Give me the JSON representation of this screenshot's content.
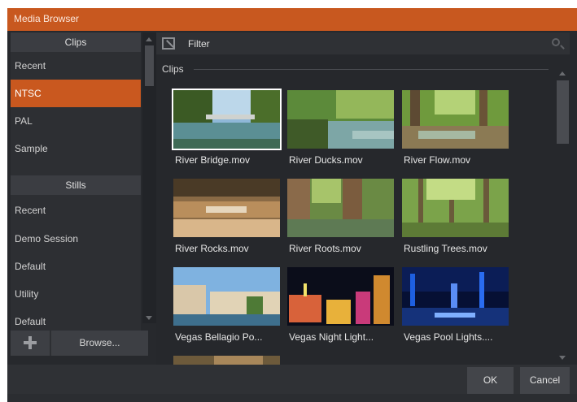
{
  "window": {
    "title": "Media Browser"
  },
  "sidebar": {
    "clips_header": "Clips",
    "clips_items": [
      {
        "label": "Recent",
        "selected": false
      },
      {
        "label": "NTSC",
        "selected": true
      },
      {
        "label": "PAL",
        "selected": false
      },
      {
        "label": "Sample",
        "selected": false
      }
    ],
    "stills_header": "Stills",
    "stills_items": [
      {
        "label": "Recent"
      },
      {
        "label": "Demo Session"
      },
      {
        "label": "Default"
      },
      {
        "label": "Utility"
      },
      {
        "label": "Default"
      }
    ],
    "add_icon": "plus-icon",
    "browse_label": "Browse..."
  },
  "filter": {
    "label": "Filter",
    "icon": "filter-icon",
    "search_icon": "search-icon"
  },
  "content": {
    "section_label": "Clips",
    "items": [
      {
        "label": "River Bridge.mov",
        "selected": true
      },
      {
        "label": "River Ducks.mov",
        "selected": false
      },
      {
        "label": "River Flow.mov",
        "selected": false
      },
      {
        "label": "River Rocks.mov",
        "selected": false
      },
      {
        "label": "River Roots.mov",
        "selected": false
      },
      {
        "label": "Rustling Trees.mov",
        "selected": false
      },
      {
        "label": "Vegas Bellagio Po...",
        "selected": false
      },
      {
        "label": "Vegas Night Light...",
        "selected": false
      },
      {
        "label": "Vegas Pool Lights....",
        "selected": false
      }
    ]
  },
  "footer": {
    "ok_label": "OK",
    "cancel_label": "Cancel"
  },
  "colors": {
    "accent": "#c8581f",
    "background": "#27292d",
    "panel": "#2d2f33"
  }
}
